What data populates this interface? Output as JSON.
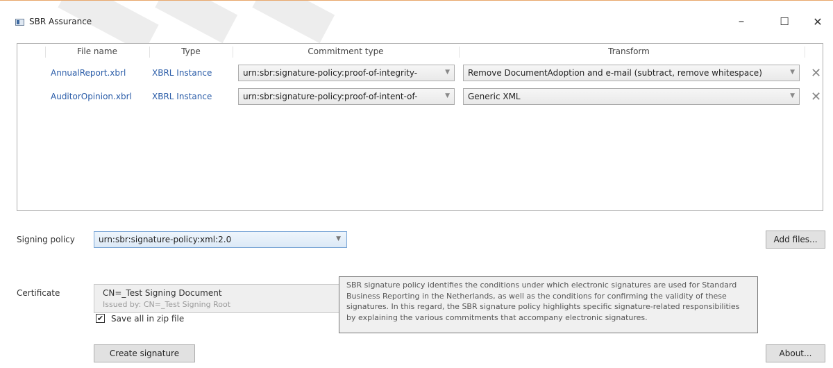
{
  "window": {
    "title": "SBR Assurance",
    "minimize_symbol": "–",
    "maximize_symbol": "☐",
    "close_symbol": "✕"
  },
  "grid": {
    "headers": [
      "File name",
      "Type",
      "Commitment type",
      "Transform"
    ],
    "rows": [
      {
        "file_name": "AnnualReport.xbrl",
        "type": "XBRL Instance",
        "commitment_type": "urn:sbr:signature-policy:proof-of-integrity-",
        "transform": "Remove DocumentAdoption and e-mail (subtract, remove whitespace)",
        "remove_symbol": "✕"
      },
      {
        "file_name": "AuditorOpinion.xbrl",
        "type": "XBRL Instance",
        "commitment_type": "urn:sbr:signature-policy:proof-of-intent-of-",
        "transform": "Generic XML",
        "remove_symbol": "✕"
      }
    ]
  },
  "signing_policy": {
    "label": "Signing policy",
    "value": "urn:sbr:signature-policy:xml:2.0"
  },
  "certificate": {
    "label": "Certificate",
    "name": "CN=_Test Signing Document",
    "issuer": "Issued by: CN=_Test Signing Root"
  },
  "options": {
    "save_zip_label": "Save all in zip file",
    "save_zip_checked": true
  },
  "buttons": {
    "add_files": "Add files...",
    "create_signature": "Create signature",
    "about": "About..."
  },
  "tooltip": {
    "text": "SBR signature policy identifies the conditions under which electronic signatures are used for Standard Business Reporting in the Netherlands, as well as the conditions for confirming the validity of these signatures. In this regard, the SBR signature policy highlights specific signature-related responsibilities by explaining the various commitments that accompany electronic signatures."
  },
  "icons": {
    "dropdown_arrow": "▼",
    "checkmark": "✔"
  }
}
